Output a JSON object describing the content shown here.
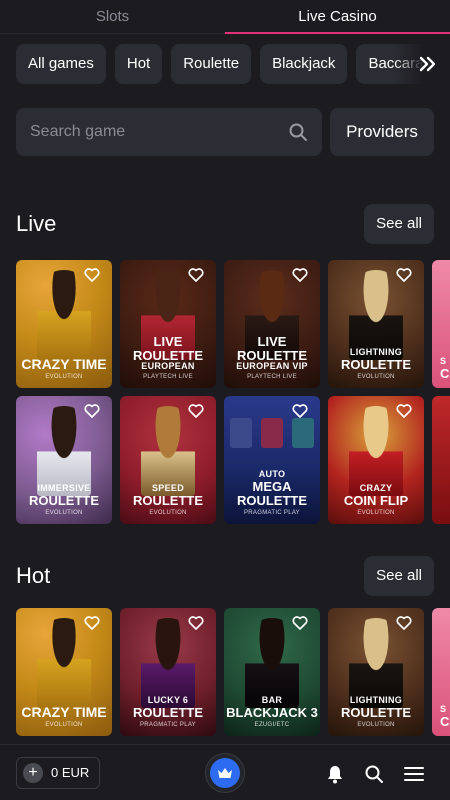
{
  "tabs": [
    {
      "label": "Slots",
      "active": false
    },
    {
      "label": "Live Casino",
      "active": true
    }
  ],
  "categories": [
    "All games",
    "Hot",
    "Roulette",
    "Blackjack",
    "Baccarat"
  ],
  "search": {
    "placeholder": "Search game",
    "providers_label": "Providers"
  },
  "sections": [
    {
      "title": "Live",
      "see_all": "See all"
    },
    {
      "title": "Hot",
      "see_all": "See all"
    }
  ],
  "live_games_row1": [
    {
      "top": "",
      "main": "CRAZY TIME",
      "sub": "EVOLUTION",
      "bg": "#c48a18"
    },
    {
      "top": "LIVE",
      "main": "ROULETTE",
      "main2": "EUROPEAN",
      "sub": "PLAYTECH LIVE",
      "bg": "#3a1a10"
    },
    {
      "top": "LIVE",
      "main": "ROULETTE",
      "main2": "EUROPEAN VIP",
      "sub": "PLAYTECH LIVE",
      "bg": "#3b1b12"
    },
    {
      "top": "LIGHTNING",
      "main": "ROULETTE",
      "sub": "EVOLUTION",
      "bg": "#4a2c1a"
    },
    {
      "top": "S",
      "main": "CA",
      "sub": "",
      "bg": "#d9527a"
    }
  ],
  "live_games_row2": [
    {
      "top": "IMMERSIVE",
      "main": "ROULETTE",
      "sub": "EVOLUTION",
      "bg": "#7b5a8e"
    },
    {
      "top": "SPEED",
      "main": "ROULETTE",
      "sub": "EVOLUTION",
      "bg": "#8e1c2a"
    },
    {
      "top": "AUTO",
      "main": "MEGA",
      "main2": "ROULETTE",
      "sub": "PRAGMATIC PLAY",
      "bg": "#1b2a6a"
    },
    {
      "top": "CRAZY",
      "main": "COIN FLIP",
      "sub": "EVOLUTION",
      "bg": "#b2231f"
    },
    {
      "top": "",
      "main": "",
      "sub": "",
      "bg": "#9a1a1a"
    }
  ],
  "hot_games_row1": [
    {
      "top": "",
      "main": "CRAZY TIME",
      "sub": "EVOLUTION",
      "bg": "#c48a18"
    },
    {
      "top": "LUCKY 6",
      "main": "ROULETTE",
      "sub": "PRAGMATIC PLAY",
      "bg": "#6e1f2a"
    },
    {
      "top": "BAR",
      "main": "BLACKJACK 3",
      "sub": "EZUGI/ETC",
      "bg": "#1f4a33"
    },
    {
      "top": "LIGHTNING",
      "main": "ROULETTE",
      "sub": "EVOLUTION",
      "bg": "#4a2c1a"
    },
    {
      "top": "S",
      "main": "CA",
      "sub": "",
      "bg": "#d9527a"
    }
  ],
  "balance": {
    "amount": "0 EUR"
  },
  "colors": {
    "accent": "#e0337a",
    "surface": "#2c2c34",
    "background": "#1b1b20",
    "crown": "#2d6cf0"
  },
  "icons": [
    "chevrons-right-icon",
    "search-icon",
    "heart-icon",
    "plus-icon",
    "crown-icon",
    "bell-icon",
    "search-icon",
    "menu-icon"
  ]
}
